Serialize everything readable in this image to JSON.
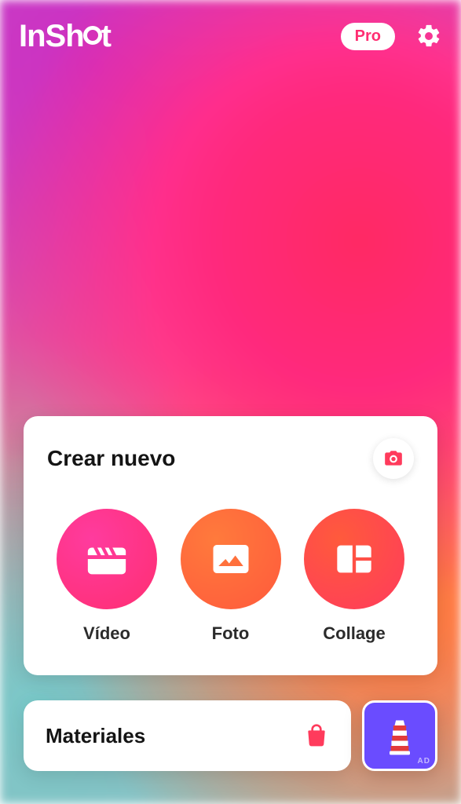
{
  "app": {
    "name": "InShOt"
  },
  "topbar": {
    "pro_label": "Pro",
    "settings_icon": "gear-icon"
  },
  "create": {
    "title": "Crear nuevo",
    "camera_icon": "camera-icon",
    "items": [
      {
        "key": "video",
        "label": "Vídeo",
        "icon": "clapper-icon"
      },
      {
        "key": "photo",
        "label": "Foto",
        "icon": "photo-icon"
      },
      {
        "key": "collage",
        "label": "Collage",
        "icon": "collage-icon"
      }
    ]
  },
  "materials": {
    "title": "Materiales",
    "bag_icon": "shopping-bag-icon"
  },
  "ad": {
    "label": "AD",
    "icon": "lighthouse-icon"
  },
  "colors": {
    "accent_pink": "#ff2e72",
    "accent_orange": "#ff5a3c",
    "ad_bg": "#6a4cff"
  }
}
